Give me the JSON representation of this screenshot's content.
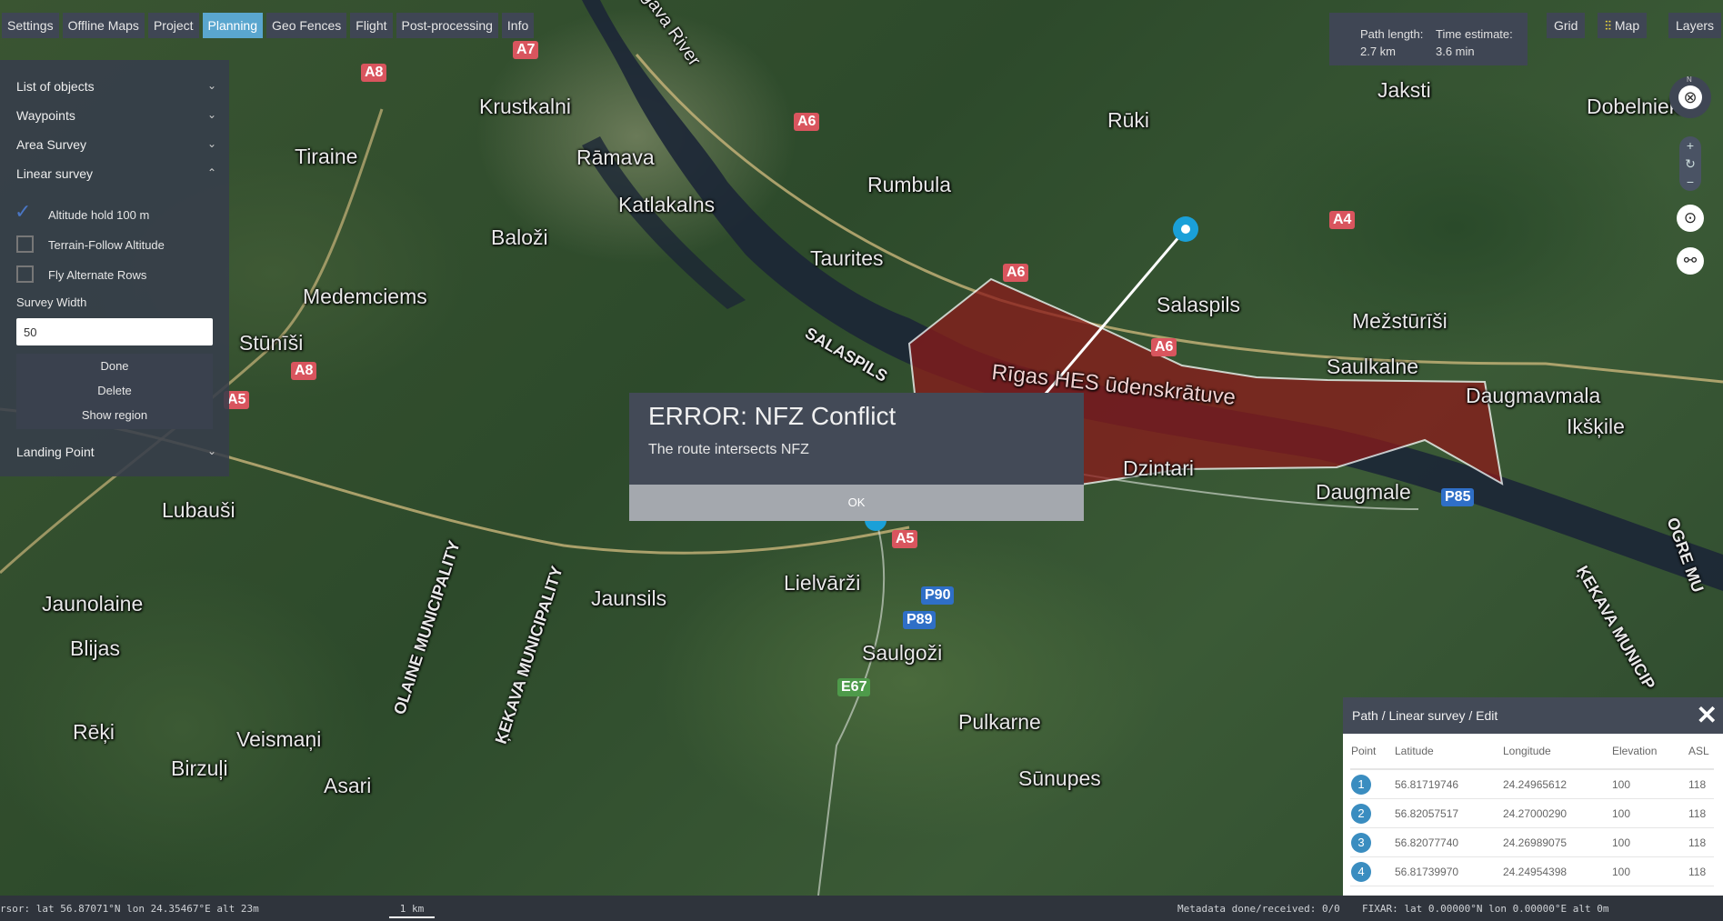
{
  "top_nav": [
    {
      "label": "Settings",
      "active": false
    },
    {
      "label": "Offline Maps",
      "active": false
    },
    {
      "label": "Project",
      "active": false
    },
    {
      "label": "Planning",
      "active": true
    },
    {
      "label": "Geo Fences",
      "active": false
    },
    {
      "label": "Flight",
      "active": false
    },
    {
      "label": "Post-processing",
      "active": false
    },
    {
      "label": "Info",
      "active": false
    }
  ],
  "stats": {
    "path_length_label": "Path length:",
    "path_length_value": "2.7 km",
    "time_estimate_label": "Time estimate:",
    "time_estimate_value": "3.6 min"
  },
  "right_buttons": {
    "grid": "Grid",
    "map": "Map",
    "layers": "Layers"
  },
  "map_controls": {
    "compass_north": "N",
    "zoom_in": "+",
    "reset": "↻",
    "zoom_out": "−"
  },
  "left_panel": {
    "sections": {
      "list_of_objects": "List of objects",
      "waypoints": "Waypoints",
      "area_survey": "Area Survey",
      "linear_survey": "Linear survey",
      "landing_point": "Landing Point"
    },
    "options": [
      {
        "label": "Altitude hold 100 m",
        "checked": true
      },
      {
        "label": "Terrain-Follow Altitude",
        "checked": false
      },
      {
        "label": "Fly Alternate Rows",
        "checked": false
      }
    ],
    "survey_width_label": "Survey Width",
    "survey_width_value": "50",
    "buttons": {
      "done": "Done",
      "delete": "Delete",
      "show_region": "Show region"
    }
  },
  "modal": {
    "title": "ERROR: NFZ Conflict",
    "message": "The route intersects NFZ",
    "ok": "OK"
  },
  "path_panel": {
    "title": "Path / Linear survey / Edit",
    "columns": [
      "Point",
      "Latitude",
      "Longitude",
      "Elevation",
      "ASL"
    ],
    "rows": [
      {
        "point": "1",
        "lat": "56.81719746",
        "lon": "24.24965612",
        "elev": "100",
        "asl": "118"
      },
      {
        "point": "2",
        "lat": "56.82057517",
        "lon": "24.27000290",
        "elev": "100",
        "asl": "118"
      },
      {
        "point": "3",
        "lat": "56.82077740",
        "lon": "24.26989075",
        "elev": "100",
        "asl": "118"
      },
      {
        "point": "4",
        "lat": "56.81739970",
        "lon": "24.24954398",
        "elev": "100",
        "asl": "118"
      }
    ]
  },
  "status_bar": {
    "cursor": "rsor: lat 56.87071°N  lon 24.35467°E  alt 23m",
    "scale": "1 km",
    "metadata": "Metadata done/received: 0/0",
    "fixar": "FIXAR: lat 0.00000°N   lon 0.00000°E   alt 0m"
  },
  "map_labels": {
    "places": [
      "Krustkalni",
      "Rāmava",
      "Rumbula",
      "Katlakalns",
      "Tiraine",
      "Baloži",
      "Taurites",
      "Medemciems",
      "Stūnīši",
      "Salaspils",
      "Rūki",
      "Jaksti",
      "Dobelnieki",
      "Mežstūrīši",
      "Saulkalne",
      "Daugmale",
      "Daugmavmala",
      "Ikšķile",
      "Dzintari",
      "Lubauši",
      "Jaunolaine",
      "Blijas",
      "Rēķi",
      "Veismaņi",
      "Birzuļi",
      "Asari",
      "Jaunsils",
      "Lielvārži",
      "Saulgoži",
      "Pulkarne",
      "Sūnupes"
    ],
    "reservoir": "Rīgas HES ūdenskrātuve",
    "river": "gava River",
    "salaspils_road": "SALASPILS",
    "olaine": "OLAINE MUNICIPALITY",
    "kekava": "ĶEKAVA MUNICIPALITY",
    "ogre": "OGRE MU",
    "kekava_right": "ĶEKAVA MUNICIP"
  },
  "road_badges": [
    "A7",
    "A8",
    "A6",
    "A6",
    "A6",
    "A4",
    "A8",
    "A5",
    "A5",
    "P85",
    "P90",
    "P89",
    "E67"
  ],
  "colors": {
    "nfz_fill": "#8b1a1a",
    "active_tab": "#5aa6cf",
    "waypoint": "#1aa0d8"
  }
}
